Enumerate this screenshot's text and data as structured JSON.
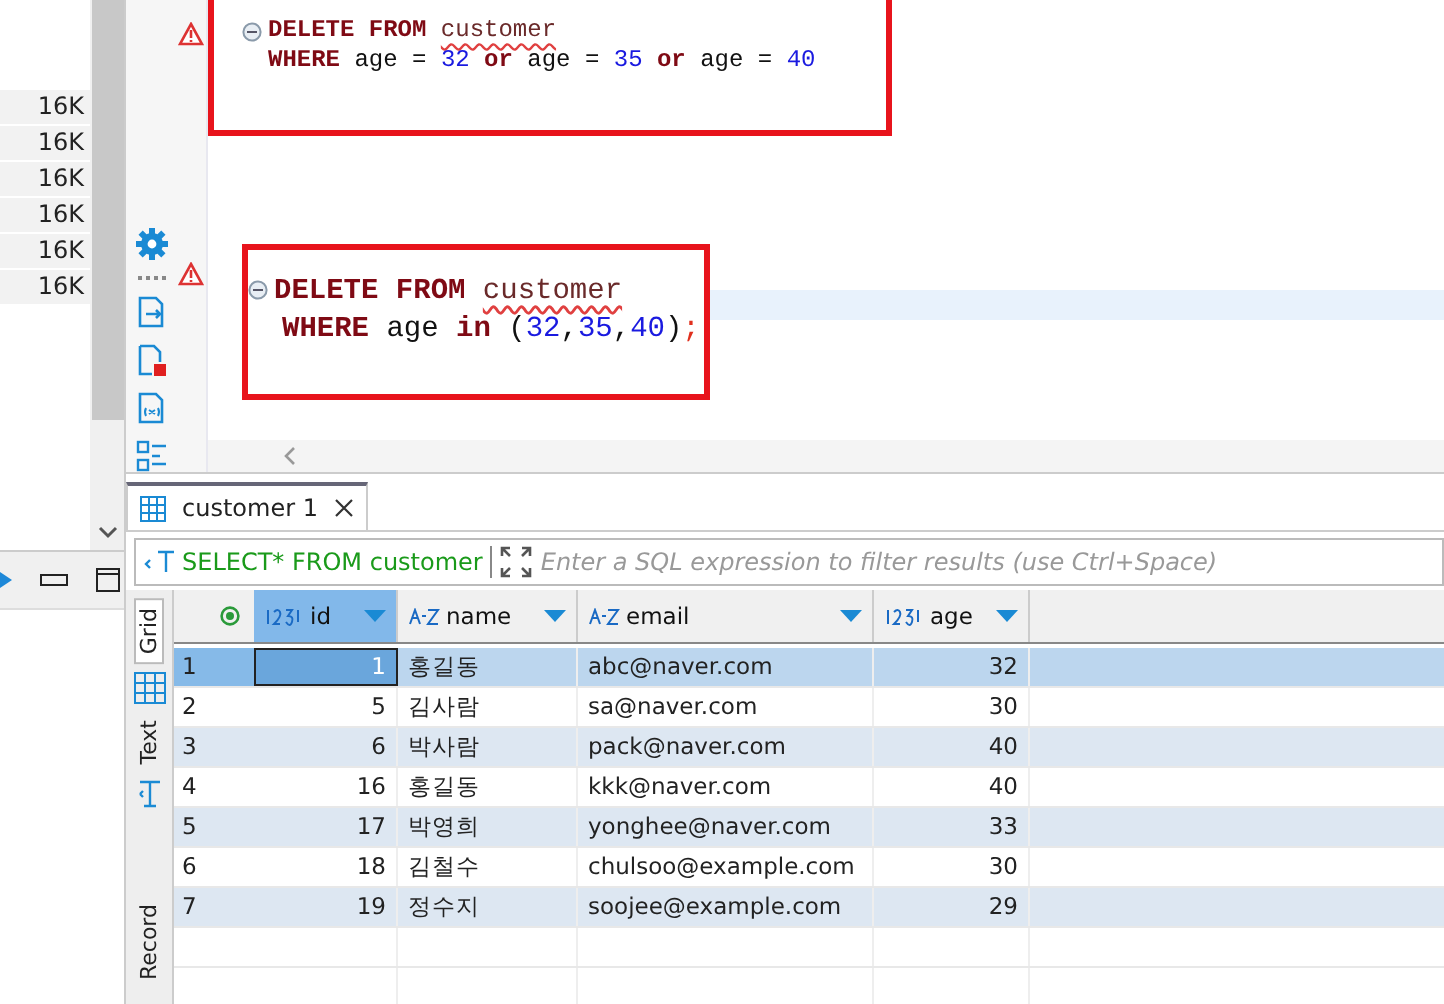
{
  "side_panel": {
    "sizes": [
      "16K",
      "16K",
      "16K",
      "16K",
      "16K",
      "16K"
    ]
  },
  "editor": {
    "statements": [
      {
        "warning": true,
        "lines": [
          [
            {
              "t": "DELETE FROM ",
              "kind": "kw"
            },
            {
              "t": "customer",
              "kind": "table"
            }
          ],
          [
            {
              "t": "WHERE",
              "kind": "kw"
            },
            {
              "t": " age = ",
              "kind": "plain"
            },
            {
              "t": "32",
              "kind": "num"
            },
            {
              "t": " or ",
              "kind": "kw"
            },
            {
              "t": "age = ",
              "kind": "plain"
            },
            {
              "t": "35",
              "kind": "num"
            },
            {
              "t": " or ",
              "kind": "kw"
            },
            {
              "t": "age = ",
              "kind": "plain"
            },
            {
              "t": "40",
              "kind": "num"
            }
          ]
        ]
      },
      {
        "warning": true,
        "lines": [
          [
            {
              "t": "DELETE FROM ",
              "kind": "kw"
            },
            {
              "t": "customer",
              "kind": "table"
            }
          ],
          [
            {
              "t": "WHERE",
              "kind": "kw"
            },
            {
              "t": " age ",
              "kind": "plain"
            },
            {
              "t": "in",
              "kind": "kw"
            },
            {
              "t": " (",
              "kind": "plain"
            },
            {
              "t": "32",
              "kind": "num"
            },
            {
              "t": ",",
              "kind": "plain"
            },
            {
              "t": "35",
              "kind": "num"
            },
            {
              "t": ",",
              "kind": "plain"
            },
            {
              "t": "40",
              "kind": "num"
            },
            {
              "t": ")",
              "kind": "plain"
            },
            {
              "t": ";",
              "kind": "punct"
            }
          ]
        ]
      }
    ]
  },
  "results": {
    "tabs": [
      {
        "label": "customer 1",
        "selected": true
      }
    ],
    "filter": {
      "query": "SELECT* FROM customer",
      "placeholder": "Enter a SQL expression to filter results (use Ctrl+Space)"
    },
    "view_tabs": [
      {
        "label": "Grid",
        "selected": true
      },
      {
        "label": "Text",
        "selected": false
      },
      {
        "label": "Record",
        "selected": false
      }
    ],
    "columns": [
      {
        "label": "id",
        "kind": "num"
      },
      {
        "label": "name",
        "kind": "text"
      },
      {
        "label": "email",
        "kind": "text"
      },
      {
        "label": "age",
        "kind": "num"
      }
    ],
    "rows": [
      {
        "num": "1",
        "selected": true,
        "cells": [
          "1",
          "홍길동",
          "abc@naver.com",
          "32"
        ]
      },
      {
        "num": "2",
        "selected": false,
        "cells": [
          "5",
          "김사람",
          "sa@naver.com",
          "30"
        ]
      },
      {
        "num": "3",
        "selected": false,
        "cells": [
          "6",
          "박사람",
          "pack@naver.com",
          "40"
        ]
      },
      {
        "num": "4",
        "selected": false,
        "cells": [
          "16",
          "홍길동",
          "kkk@naver.com",
          "40"
        ]
      },
      {
        "num": "5",
        "selected": false,
        "cells": [
          "17",
          "박영희",
          "yonghee@naver.com",
          "33"
        ]
      },
      {
        "num": "6",
        "selected": false,
        "cells": [
          "18",
          "김철수",
          "chulsoo@example.com",
          "30"
        ]
      },
      {
        "num": "7",
        "selected": false,
        "cells": [
          "19",
          "정수지",
          "soojee@example.com",
          "29"
        ]
      }
    ]
  }
}
